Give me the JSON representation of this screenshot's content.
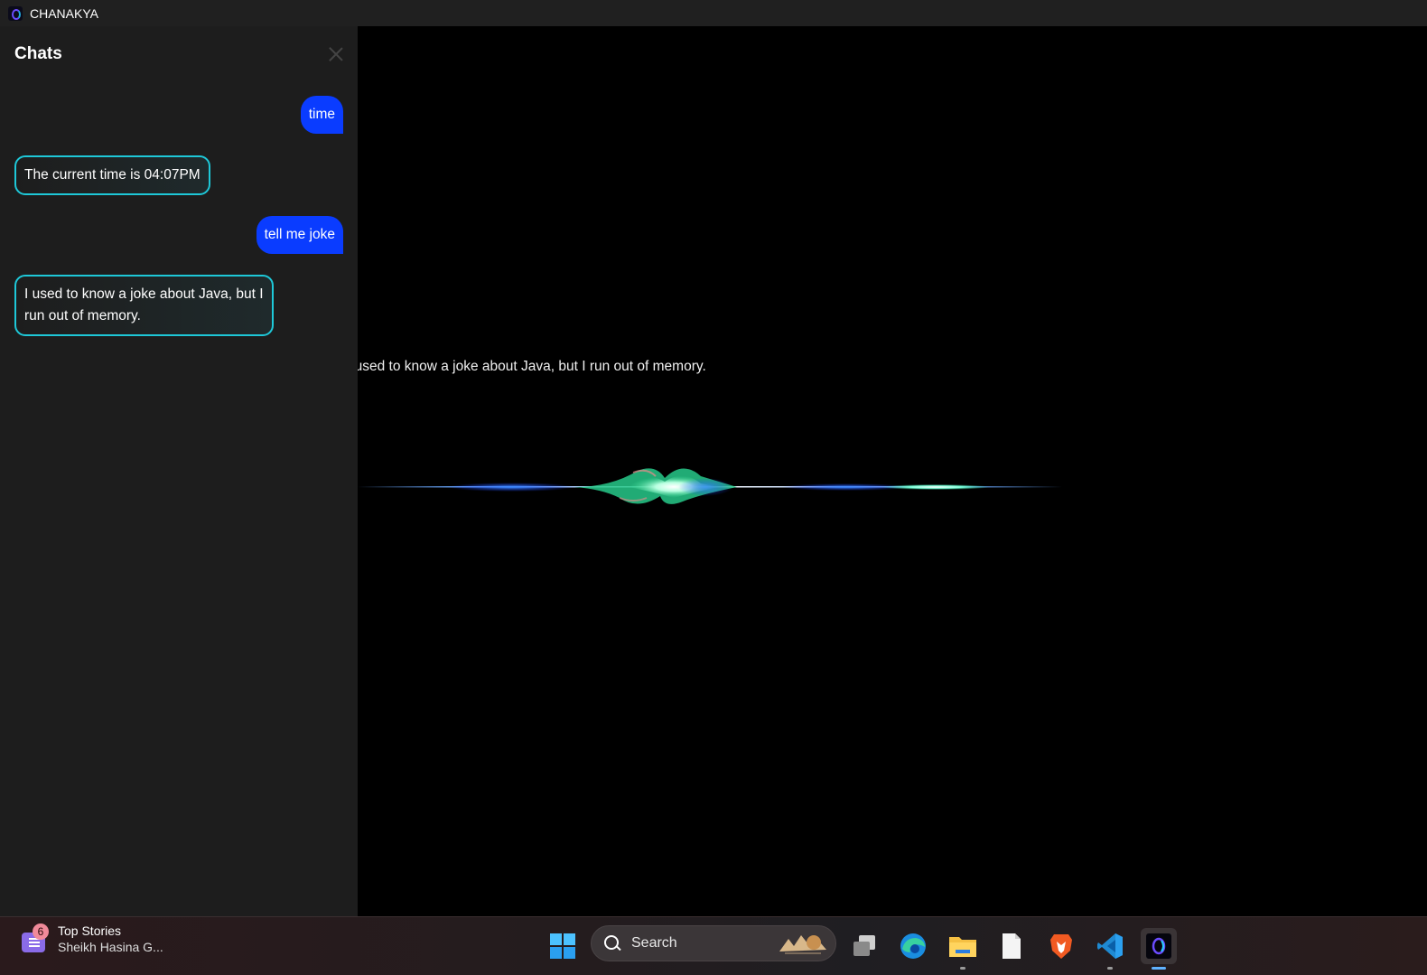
{
  "window": {
    "title": "CHANAKYA"
  },
  "chat": {
    "header": "Chats",
    "messages": [
      {
        "role": "user",
        "text": "time"
      },
      {
        "role": "bot",
        "text": "The current time is 04:07PM"
      },
      {
        "role": "user",
        "text": "tell me joke"
      },
      {
        "role": "bot",
        "text": "I used to know a joke about Java, but I run out of memory."
      }
    ]
  },
  "stage": {
    "response_text": "I used to know a joke about Java, but I run out of memory."
  },
  "taskbar": {
    "news": {
      "badge": "6",
      "title": "Top Stories",
      "subtitle": "Sheikh Hasina G..."
    },
    "search": {
      "label": "Search"
    },
    "apps": [
      "windows-start",
      "task-view",
      "edge",
      "file-explorer",
      "notepad",
      "brave",
      "vscode",
      "chanakya"
    ]
  },
  "colors": {
    "user_bubble": "#0a3cff",
    "bot_border": "#1ec8d8",
    "panel_bg": "#1d1d1d",
    "titlebar_bg": "#202020"
  }
}
